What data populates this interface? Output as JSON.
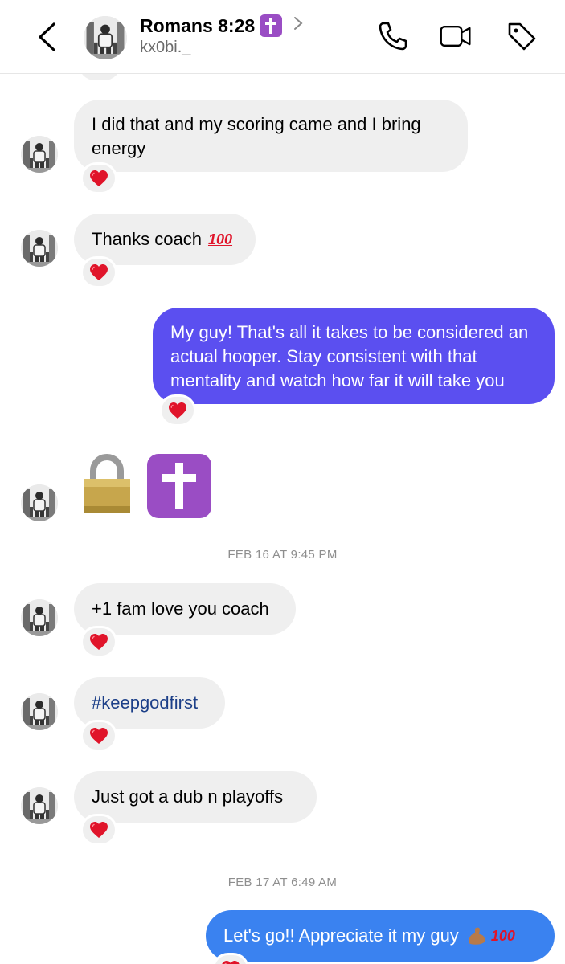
{
  "header": {
    "title": "Romans 8:28",
    "username": "kx0bi._"
  },
  "messages": [
    {
      "text": "I did that and my scoring came and I bring energy"
    },
    {
      "text": "Thanks coach"
    },
    {
      "text": "My guy! That's all it takes to be considered an actual hooper. Stay consistent with that mentality and watch how far it will take you"
    },
    {
      "text": "+1 fam love you coach"
    },
    {
      "text": "#keepgodfirst"
    },
    {
      "text": "Just got a dub n playoffs"
    },
    {
      "text": "Let's go!! Appreciate it my guy"
    }
  ],
  "timestamps": [
    "FEB 16 AT 9:45 PM",
    "FEB 17 AT 6:49 AM"
  ],
  "icons": [
    "back-chevron-icon",
    "chevron-right-icon",
    "phone-icon",
    "video-camera-icon",
    "tag-icon",
    "heart-reaction-icon",
    "lock-emoji",
    "latin-cross-emoji",
    "hundred-points-emoji",
    "flexed-biceps-emoji"
  ],
  "colors": {
    "outgoing_purple": "#5b4ff0",
    "outgoing_blue": "#3a82f0",
    "incoming": "#efefef",
    "hashtag": "#1c3f88",
    "heart": "#e0142a"
  }
}
